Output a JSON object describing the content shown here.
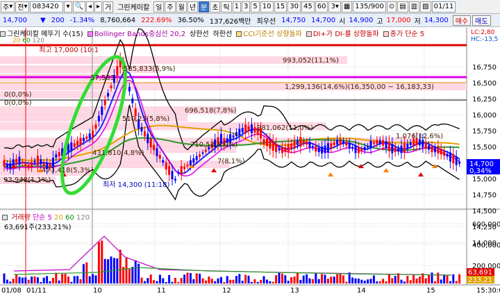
{
  "toolbar": {
    "type_label": "주",
    "dropdown1": "전",
    "code": "083420",
    "group_label": "거",
    "name": "그린케미칼",
    "periods": [
      "일",
      "주",
      "월",
      "년",
      "분",
      "초",
      "틱"
    ],
    "minute_options": [
      "1",
      "3",
      "5",
      "10",
      "15",
      "30",
      "45",
      "60"
    ],
    "selected_period": "분",
    "current_interval": "3",
    "count": "135/900",
    "date": "01/11"
  },
  "quote": {
    "price": "14,700",
    "change": "200",
    "change_pct": "-1.34%",
    "volume": "8,760,664",
    "vol_ratio": "222.69%",
    "turnover": "36.50%",
    "amount": "137,626백만",
    "sell_label": "최우선",
    "best_ask": "14,750",
    "best_bid": "14,700",
    "open_label": "시",
    "open": "14,900",
    "high_label": "고",
    "high": "17,000",
    "low_label": "저",
    "low": "14,300",
    "buy_btn": "매수",
    "sell_btn": "매도"
  },
  "legend": {
    "items": [
      {
        "text": "그린케미칼 메뚜기 수(15)",
        "color": "#000000"
      },
      {
        "text": "Bollinger Bands중심선 20,2",
        "color": "#a000a0"
      },
      {
        "text": "상한선",
        "color": "#000000"
      },
      {
        "text": "하한선",
        "color": "#000000"
      },
      {
        "text": "CCI기준선 상향돌파",
        "color": "#c08000"
      },
      {
        "text": "DI+가 DI-를 상향돌파",
        "color": "#c00000"
      },
      {
        "text": "종가 단순 5",
        "color": "#c00000"
      }
    ],
    "ma_legend": [
      "20",
      "60",
      "120"
    ],
    "lc": "LC:2,80",
    "hc": "HC:-13,5"
  },
  "annotations": {
    "high_marker": "최고 17,000 (10:1",
    "low_marker": "최저 14,300 (11:18)",
    "vp": [
      {
        "text": "993,052(11,1%)"
      },
      {
        "text": "585,833(5,9%)"
      },
      {
        "text": "37,583"
      },
      {
        "text": "1,299,136(14,6%)(16,350,00 ~ 16,183,33)"
      },
      {
        "text": "0(0,0%)"
      },
      {
        "text": "0(0,0%)"
      },
      {
        "text": "696,518(7,8%)"
      },
      {
        "text": "510,23(5,8%)"
      },
      {
        "text": "981,062(11,0%)"
      },
      {
        "text": "1,076(12,6%)"
      },
      {
        "text": "710,52(8,0%)"
      },
      {
        "text": "431,810(4,8%)"
      },
      {
        "text": "7(8,1%)"
      },
      {
        "text": "473,418(5,3%)"
      },
      {
        "text": "93,948(1,1%)"
      }
    ]
  },
  "price_axis": {
    "labels": [
      "16,750",
      "16,500",
      "16,250",
      "16,000",
      "15,750",
      "15,500",
      "15,250",
      "15,000",
      "14,750",
      "14,500",
      "14,250",
      "14,000"
    ],
    "current_badge": "14,700",
    "current_pct": "0,34%"
  },
  "volume": {
    "legend_name": "거래량",
    "legend_ma": "단순 5",
    "legend_periods": [
      "20",
      "60",
      "120"
    ],
    "current_value": "63,691주(233,21%)",
    "axis_labels": [
      "600,000",
      "400,000",
      "200,000"
    ],
    "badge1": "63,691",
    "badge2": "233,21"
  },
  "time_axis": {
    "labels": [
      "01/08",
      "01/11",
      "10",
      "11",
      "12",
      "13",
      "14",
      "15",
      "15:30:0"
    ]
  },
  "colors": {
    "up": "#ff0000",
    "down": "#0000ff",
    "band": "#000000",
    "highlight_green": "#33dd33"
  }
}
